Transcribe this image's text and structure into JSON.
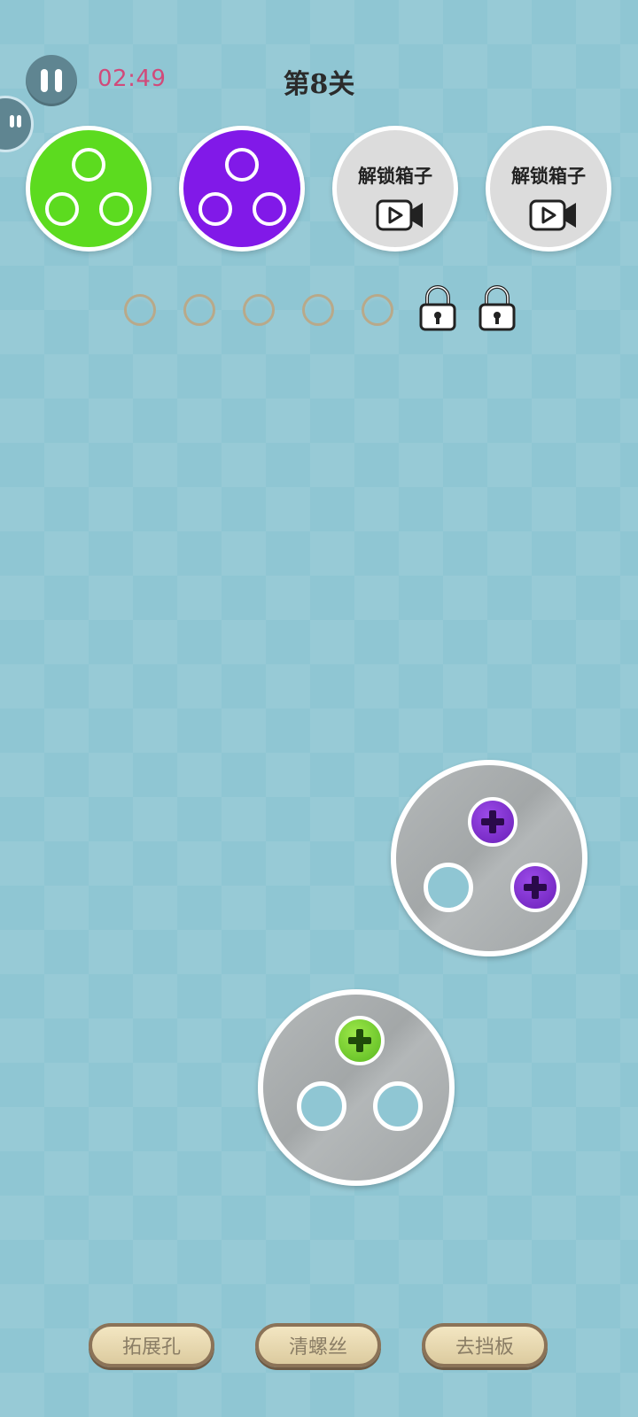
{
  "header": {
    "timer": "02:49",
    "level": "第8关"
  },
  "boxes": [
    {
      "color": "#5cdb1f",
      "state": "active"
    },
    {
      "color": "#8119e8",
      "state": "active"
    },
    {
      "label": "解锁箱子",
      "state": "locked",
      "icon": "video-icon"
    },
    {
      "label": "解锁箱子",
      "state": "locked",
      "icon": "video-icon"
    }
  ],
  "slots": {
    "empty_count": 5,
    "locked_count": 2
  },
  "plates": [
    {
      "screws": [
        "purple",
        "purple"
      ],
      "empty_holes": 1
    },
    {
      "screws": [
        "green"
      ],
      "empty_holes": 2
    }
  ],
  "tools": {
    "expand_hole": "拓展孔",
    "clear_screw": "清螺丝",
    "remove_board": "去挡板"
  },
  "colors": {
    "green": "#5cdb1f",
    "purple": "#8119e8",
    "background": "#8fc6d3"
  }
}
